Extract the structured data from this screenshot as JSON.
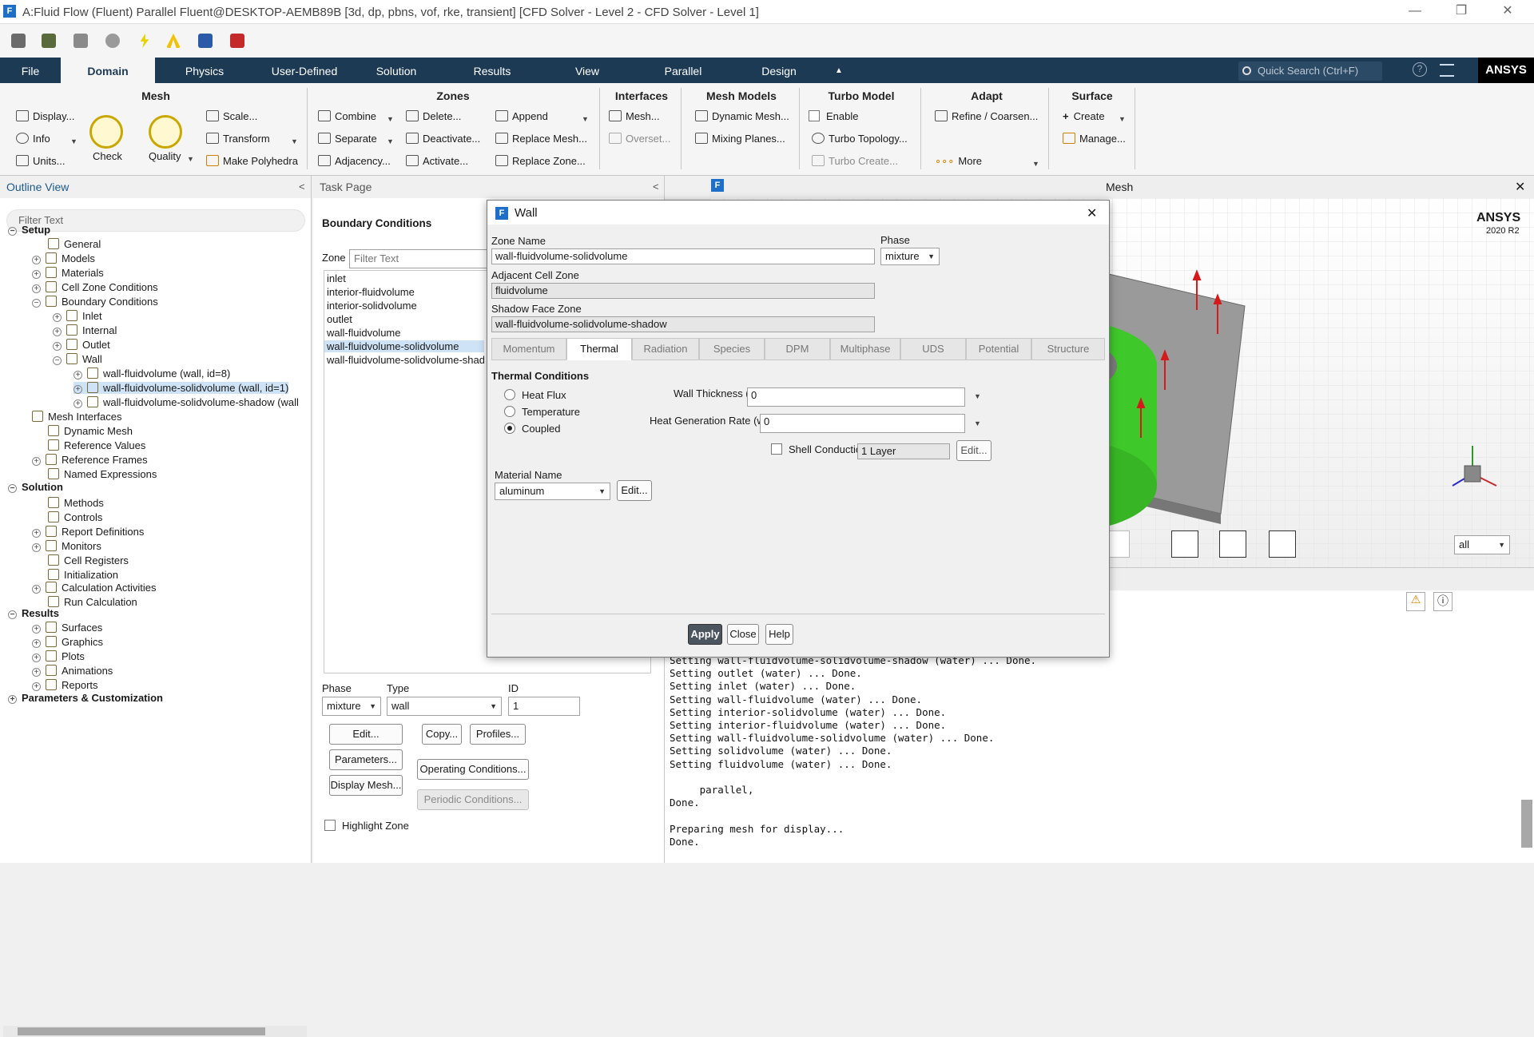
{
  "window": {
    "title": "A:Fluid Flow (Fluent) Parallel Fluent@DESKTOP-AEMB89B  [3d, dp, pbns, vof, rke, transient] [CFD Solver - Level 2 - CFD Solver - Level 1]",
    "app_icon": "F",
    "minimize": "—",
    "restore": "❐",
    "close": "✕"
  },
  "menu": {
    "tabs": [
      "File",
      "Domain",
      "Physics",
      "User-Defined",
      "Solution",
      "Results",
      "View",
      "Parallel",
      "Design"
    ],
    "collapse_caret": "▲",
    "quick_search_placeholder": "Quick Search (Ctrl+F)",
    "brand": "ANSYS"
  },
  "ribbon": {
    "mesh": {
      "title": "Mesh",
      "display": "Display...",
      "info": "Info",
      "units": "Units...",
      "check": "Check",
      "quality": "Quality",
      "scale": "Scale...",
      "transform": "Transform",
      "make_polyhedra": "Make Polyhedra"
    },
    "zones": {
      "title": "Zones",
      "combine": "Combine",
      "separate": "Separate",
      "adjacency": "Adjacency...",
      "delete": "Delete...",
      "deactivate": "Deactivate...",
      "activate": "Activate...",
      "append": "Append",
      "replace_mesh": "Replace Mesh...",
      "replace_zone": "Replace Zone..."
    },
    "interfaces": {
      "title": "Interfaces",
      "mesh": "Mesh...",
      "overset": "Overset..."
    },
    "mesh_models": {
      "title": "Mesh Models",
      "dynamic_mesh": "Dynamic Mesh...",
      "mixing_planes": "Mixing Planes..."
    },
    "turbo": {
      "title": "Turbo Model",
      "enable": "Enable",
      "topology": "Turbo Topology...",
      "create": "Turbo Create..."
    },
    "adapt": {
      "title": "Adapt",
      "refine": "Refine / Coarsen...",
      "more": "More"
    },
    "surface": {
      "title": "Surface",
      "create": "Create",
      "manage": "Manage..."
    }
  },
  "outline": {
    "title": "Outline View",
    "collapse": "<",
    "filter_placeholder": "Filter Text",
    "items": [
      {
        "label": "Setup",
        "bold": true
      },
      {
        "label": "General"
      },
      {
        "label": "Models"
      },
      {
        "label": "Materials"
      },
      {
        "label": "Cell Zone Conditions"
      },
      {
        "label": "Boundary Conditions"
      },
      {
        "label": "Inlet"
      },
      {
        "label": "Internal"
      },
      {
        "label": "Outlet"
      },
      {
        "label": "Wall"
      },
      {
        "label": "wall-fluidvolume (wall, id=8)"
      },
      {
        "label": "wall-fluidvolume-solidvolume (wall, id=1)"
      },
      {
        "label": "wall-fluidvolume-solidvolume-shadow (wall"
      },
      {
        "label": "Mesh Interfaces"
      },
      {
        "label": "Dynamic Mesh"
      },
      {
        "label": "Reference Values"
      },
      {
        "label": "Reference Frames"
      },
      {
        "label": "Named Expressions"
      },
      {
        "label": "Solution",
        "bold": true
      },
      {
        "label": "Methods"
      },
      {
        "label": "Controls"
      },
      {
        "label": "Report Definitions"
      },
      {
        "label": "Monitors"
      },
      {
        "label": "Cell Registers"
      },
      {
        "label": "Initialization"
      },
      {
        "label": "Calculation Activities"
      },
      {
        "label": "Run Calculation"
      },
      {
        "label": "Results",
        "bold": true
      },
      {
        "label": "Surfaces"
      },
      {
        "label": "Graphics"
      },
      {
        "label": "Plots"
      },
      {
        "label": "Animations"
      },
      {
        "label": "Reports"
      },
      {
        "label": "Parameters & Customization",
        "bold": true
      }
    ]
  },
  "task_page": {
    "title": "Task Page",
    "collapse": "<",
    "heading": "Boundary Conditions",
    "zone_label": "Zone",
    "zone_filter_placeholder": "Filter Text",
    "zones": [
      "inlet",
      "interior-fluidvolume",
      "interior-solidvolume",
      "outlet",
      "wall-fluidvolume",
      "wall-fluidvolume-solidvolume",
      "wall-fluidvolume-solidvolume-shad"
    ],
    "selected_zone": "wall-fluidvolume-solidvolume",
    "phase_label": "Phase",
    "phase_value": "mixture",
    "type_label": "Type",
    "type_value": "wall",
    "id_label": "ID",
    "id_value": "1",
    "buttons": {
      "edit": "Edit...",
      "copy": "Copy...",
      "profiles": "Profiles...",
      "parameters": "Parameters...",
      "operating": "Operating Conditions...",
      "display_mesh": "Display Mesh...",
      "periodic": "Periodic Conditions..."
    },
    "highlight_zone": "Highlight Zone"
  },
  "graphics": {
    "title": "Mesh",
    "brand": "ANSYS",
    "version": "2020 R2",
    "view_select": "all",
    "close": "✕"
  },
  "console": {
    "lines": [
      "Setting wall-fluidvolume-solidvolume-shadow (water) ... Done.",
      "Setting outlet (water) ... Done.",
      "Setting inlet (water) ... Done.",
      "Setting wall-fluidvolume (water) ... Done.",
      "Setting interior-solidvolume (water) ... Done.",
      "Setting interior-fluidvolume (water) ... Done.",
      "Setting wall-fluidvolume-solidvolume (water) ... Done.",
      "Setting solidvolume (water) ... Done.",
      "Setting fluidvolume (water) ... Done.",
      "",
      "     parallel,",
      "Done.",
      "",
      "Preparing mesh for display...",
      "Done."
    ]
  },
  "dialog": {
    "title": "Wall",
    "close": "✕",
    "zone_name_label": "Zone Name",
    "zone_name": "wall-fluidvolume-solidvolume",
    "phase_label": "Phase",
    "phase_value": "mixture",
    "adjacent_label": "Adjacent Cell Zone",
    "adjacent_value": "fluidvolume",
    "shadow_label": "Shadow Face Zone",
    "shadow_value": "wall-fluidvolume-solidvolume-shadow",
    "tabs": [
      "Momentum",
      "Thermal",
      "Radiation",
      "Species",
      "DPM",
      "Multiphase",
      "UDS",
      "Potential",
      "Structure"
    ],
    "active_tab": "Thermal",
    "thermal_title": "Thermal Conditions",
    "radio_heat_flux": "Heat Flux",
    "radio_temperature": "Temperature",
    "radio_coupled": "Coupled",
    "selected_condition": "Coupled",
    "wall_thickness_label": "Wall Thickness (m)",
    "wall_thickness_value": "0",
    "heat_gen_label": "Heat Generation Rate (w/m3)",
    "heat_gen_value": "0",
    "shell_conduction_label": "Shell Conduction",
    "layers_value": "1 Layer",
    "layers_edit": "Edit...",
    "material_label": "Material Name",
    "material_value": "aluminum",
    "material_edit": "Edit...",
    "apply": "Apply",
    "close_btn": "Close",
    "help": "Help"
  },
  "colors": {
    "menubar": "#1d3a55",
    "accent": "#1e6fc7",
    "body_green": "#3fc82a",
    "frame_grey": "#9a9a9a",
    "vector_red": "#d41a1a",
    "vector_blue": "#1a2fd4"
  }
}
